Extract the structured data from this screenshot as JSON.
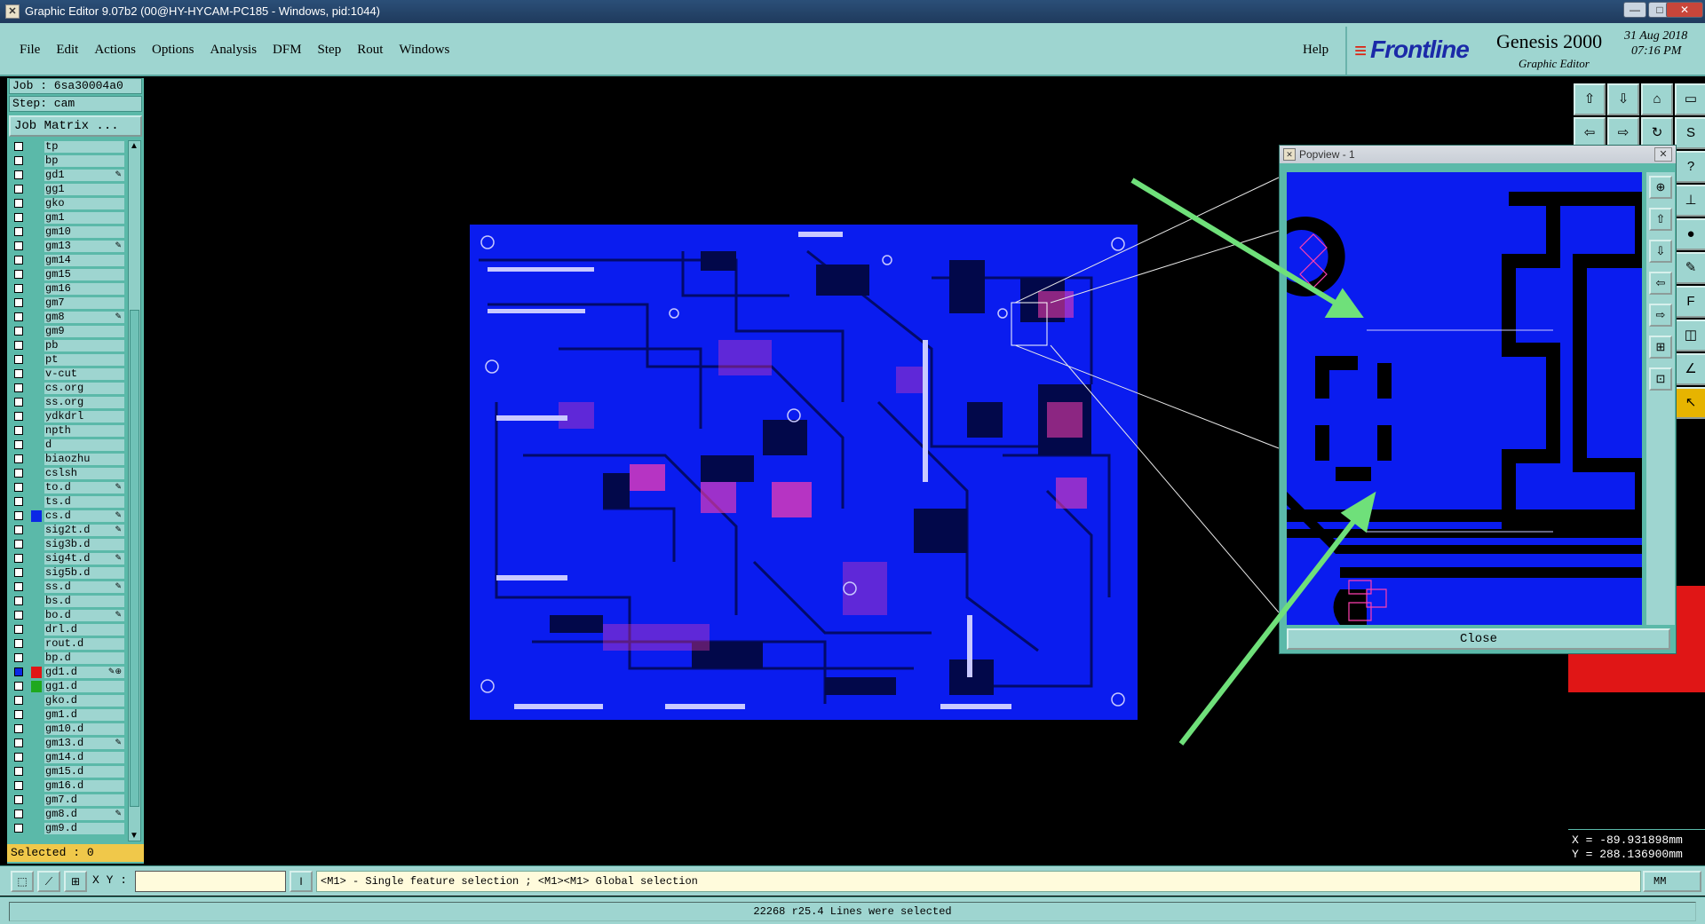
{
  "window": {
    "title": "Graphic Editor 9.07b2 (00@HY-HYCAM-PC185 - Windows, pid:1044)",
    "minimize": "—",
    "maximize": "□",
    "close": "✕"
  },
  "menubar": {
    "items": [
      "File",
      "Edit",
      "Actions",
      "Options",
      "Analysis",
      "DFM",
      "Step",
      "Rout",
      "Windows"
    ],
    "help": "Help"
  },
  "brand": {
    "logo": "Frontline",
    "product": "Genesis 2000",
    "subtitle": "Graphic Editor",
    "date": "31 Aug 2018",
    "time": "07:16 PM"
  },
  "job": {
    "job_label": "Job : 6sa30004a0",
    "step_label": "Step: cam",
    "matrix_button": "Job Matrix ..."
  },
  "layers": [
    {
      "name": "tp",
      "mark": ""
    },
    {
      "name": "bp",
      "mark": ""
    },
    {
      "name": "gd1",
      "mark": "✎"
    },
    {
      "name": "gg1",
      "mark": ""
    },
    {
      "name": "gko",
      "mark": ""
    },
    {
      "name": "gm1",
      "mark": ""
    },
    {
      "name": "gm10",
      "mark": ""
    },
    {
      "name": "gm13",
      "mark": "✎"
    },
    {
      "name": "gm14",
      "mark": ""
    },
    {
      "name": "gm15",
      "mark": ""
    },
    {
      "name": "gm16",
      "mark": ""
    },
    {
      "name": "gm7",
      "mark": ""
    },
    {
      "name": "gm8",
      "mark": "✎"
    },
    {
      "name": "gm9",
      "mark": ""
    },
    {
      "name": "pb",
      "mark": ""
    },
    {
      "name": "pt",
      "mark": ""
    },
    {
      "name": "v-cut",
      "mark": ""
    },
    {
      "name": "cs.org",
      "mark": ""
    },
    {
      "name": "ss.org",
      "mark": ""
    },
    {
      "name": "ydkdrl",
      "mark": ""
    },
    {
      "name": "npth",
      "mark": ""
    },
    {
      "name": "d",
      "mark": ""
    },
    {
      "name": "biaozhu",
      "mark": ""
    },
    {
      "name": "cslsh",
      "mark": ""
    },
    {
      "name": "to.d",
      "mark": "✎"
    },
    {
      "name": "ts.d",
      "mark": ""
    },
    {
      "name": "cs.d",
      "mark": "✎",
      "color": "#0b28e6"
    },
    {
      "name": "sig2t.d",
      "mark": "✎"
    },
    {
      "name": "sig3b.d",
      "mark": ""
    },
    {
      "name": "sig4t.d",
      "mark": "✎"
    },
    {
      "name": "sig5b.d",
      "mark": ""
    },
    {
      "name": "ss.d",
      "mark": "✎"
    },
    {
      "name": "bs.d",
      "mark": ""
    },
    {
      "name": "bo.d",
      "mark": "✎"
    },
    {
      "name": "drl.d",
      "mark": ""
    },
    {
      "name": "rout.d",
      "mark": ""
    },
    {
      "name": "bp.d",
      "mark": ""
    },
    {
      "name": "gd1.d",
      "mark": "✎⊕",
      "color": "#e01616",
      "active": true
    },
    {
      "name": "gg1.d",
      "mark": "",
      "color": "#1fa81f"
    },
    {
      "name": "gko.d",
      "mark": ""
    },
    {
      "name": "gm1.d",
      "mark": ""
    },
    {
      "name": "gm10.d",
      "mark": ""
    },
    {
      "name": "gm13.d",
      "mark": "✎"
    },
    {
      "name": "gm14.d",
      "mark": ""
    },
    {
      "name": "gm15.d",
      "mark": ""
    },
    {
      "name": "gm16.d",
      "mark": ""
    },
    {
      "name": "gm7.d",
      "mark": ""
    },
    {
      "name": "gm8.d",
      "mark": "✎"
    },
    {
      "name": "gm9.d",
      "mark": ""
    }
  ],
  "selected_label": "Selected : 0",
  "popview": {
    "title": "Popview - 1",
    "close_x": "✕",
    "close_button": "Close"
  },
  "coords": {
    "x": "X = -89.931898mm",
    "y": "Y = 288.136900mm"
  },
  "bottom": {
    "xy_label": "X Y :",
    "xy_value": "",
    "hint": "<M1> - Single feature selection ; <M1><M1> Global selection",
    "units": "MM",
    "status": "22268 r25.4 Lines were selected"
  },
  "colors": {
    "panel": "#9ed5d0",
    "panel_dark": "#5bb9a9",
    "board": "#0a1cef",
    "highlight": "#ff3fb0",
    "arrow": "#6fe07a"
  }
}
